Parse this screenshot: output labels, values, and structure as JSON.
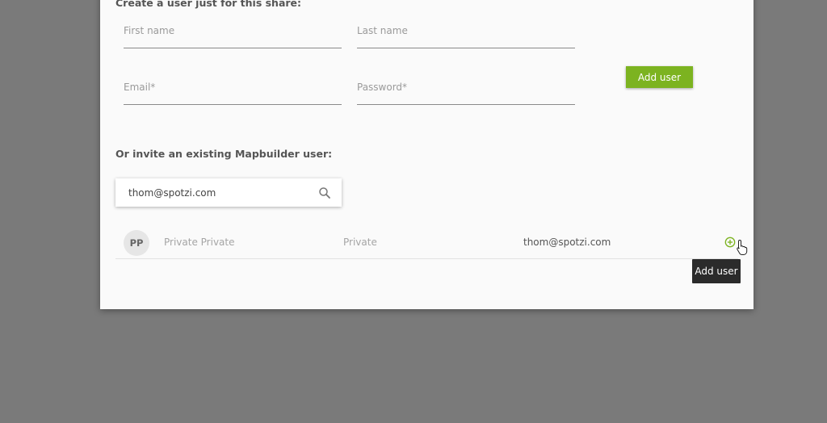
{
  "dialog": {
    "create_heading": "Create a user just for this share:",
    "first_name_placeholder": "First name",
    "last_name_placeholder": "Last name",
    "email_placeholder": "Email*",
    "password_placeholder": "Password*",
    "add_user_label": "Add user",
    "invite_heading": "Or invite an existing Mapbuilder user:",
    "search": {
      "value": "thom@spotzi.com",
      "icon": "search-icon"
    },
    "results": [
      {
        "initials": "PP",
        "name": "Private Private",
        "type": "Private",
        "email": "thom@spotzi.com",
        "action_icon": "add-circle-icon"
      }
    ],
    "tooltip": "Add user"
  },
  "colors": {
    "accent": "#7cb320",
    "overlay": "#7a7a7a",
    "dialog_bg": "#fafafa",
    "tooltip_bg": "#2b2b2b"
  }
}
